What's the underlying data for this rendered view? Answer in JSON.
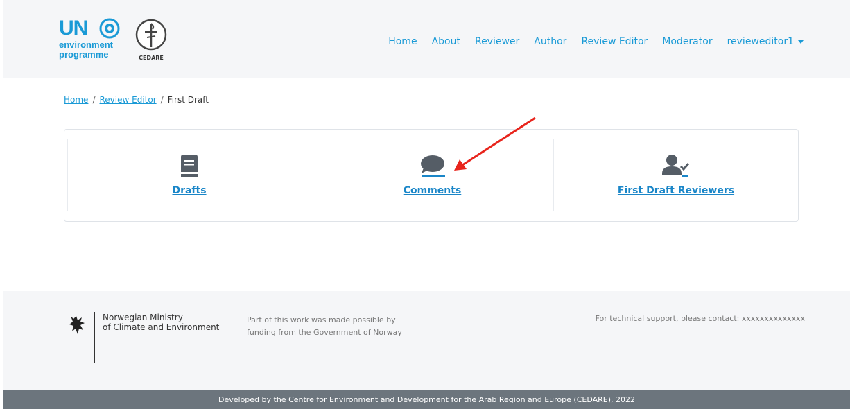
{
  "header": {
    "logo_un": "UN",
    "logo_line1": "environment",
    "logo_line2": "programme",
    "logo_cedare": "CEDARE",
    "nav": {
      "home": "Home",
      "about": "About",
      "reviewer": "Reviewer",
      "author": "Author",
      "review_editor": "Review Editor",
      "moderator": "Moderator",
      "user": "revieweditor1"
    }
  },
  "breadcrumb": {
    "home": "Home",
    "review_editor": "Review Editor",
    "current": "First Draft",
    "separator": "/"
  },
  "tiles": {
    "drafts": {
      "label": "Drafts",
      "icon": "book-icon"
    },
    "comments": {
      "label": "Comments",
      "icon": "comment-icon"
    },
    "reviewers": {
      "label": "First Draft Reviewers",
      "icon": "user-check-icon"
    }
  },
  "footer": {
    "ministry_line1": "Norwegian Ministry",
    "ministry_line2": "of Climate and Environment",
    "funding_line1": "Part of this work was made possible by",
    "funding_line2": "funding from the Government of Norway",
    "support": "For technical support, please contact: xxxxxxxxxxxxxx",
    "bottom": "Developed by the Centre for Environment and Development for the Arab Region and Europe (CEDARE), 2022"
  },
  "colors": {
    "accent": "#1a9ad6",
    "link": "#1a86c8",
    "icon": "#555d66",
    "annotation": "#e8241c",
    "bottom_bar": "#6c757d"
  }
}
